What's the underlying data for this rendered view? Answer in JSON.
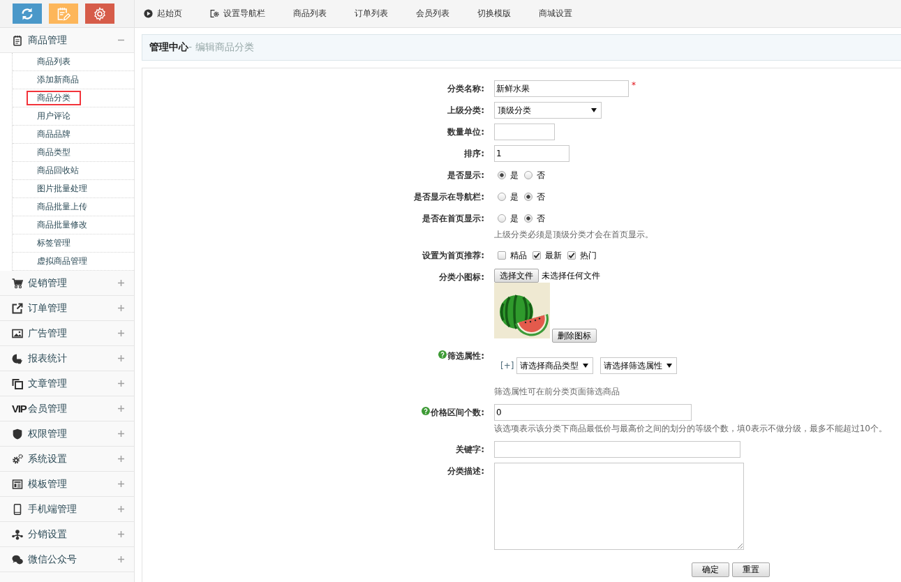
{
  "sidebar": {
    "menu": [
      {
        "label": "商品管理",
        "expanded": true,
        "children": [
          {
            "label": "商品列表",
            "selected": false
          },
          {
            "label": "添加新商品",
            "selected": false
          },
          {
            "label": "商品分类",
            "selected": true
          },
          {
            "label": "用户评论",
            "selected": false
          },
          {
            "label": "商品品牌",
            "selected": false
          },
          {
            "label": "商品类型",
            "selected": false
          },
          {
            "label": "商品回收站",
            "selected": false
          },
          {
            "label": "图片批量处理",
            "selected": false
          },
          {
            "label": "商品批量上传",
            "selected": false
          },
          {
            "label": "商品批量修改",
            "selected": false
          },
          {
            "label": "标签管理",
            "selected": false
          },
          {
            "label": "虚拟商品管理",
            "selected": false
          }
        ]
      },
      {
        "label": "促销管理",
        "expanded": false
      },
      {
        "label": "订单管理",
        "expanded": false
      },
      {
        "label": "广告管理",
        "expanded": false
      },
      {
        "label": "报表统计",
        "expanded": false
      },
      {
        "label": "文章管理",
        "expanded": false
      },
      {
        "label": "会员管理",
        "expanded": false,
        "icon_text": "VIP"
      },
      {
        "label": "权限管理",
        "expanded": false
      },
      {
        "label": "系统设置",
        "expanded": false
      },
      {
        "label": "模板管理",
        "expanded": false
      },
      {
        "label": "手机端管理",
        "expanded": false
      },
      {
        "label": "分销设置",
        "expanded": false
      },
      {
        "label": "微信公众号",
        "expanded": false
      }
    ]
  },
  "top_nav": [
    "起始页",
    "设置导航栏",
    "商品列表",
    "订单列表",
    "会员列表",
    "切换模版",
    "商城设置"
  ],
  "breadcrumb": {
    "root": "管理中心",
    "current": "- 编辑商品分类"
  },
  "form": {
    "rows": [
      {
        "kind": "text",
        "label": "分类名称:",
        "value": "新鲜水果",
        "required_mark": "*"
      },
      {
        "kind": "select",
        "label": "上级分类:",
        "value": "顶级分类"
      },
      {
        "kind": "text",
        "label": "数量单位:"
      },
      {
        "kind": "text",
        "label": "排序:",
        "value": "1"
      },
      {
        "kind": "radio",
        "label": "是否显示:",
        "options": [
          {
            "label": "是",
            "selected": true
          },
          {
            "label": "否",
            "selected": false
          }
        ]
      },
      {
        "kind": "radio",
        "label": "是否显示在导航栏:",
        "options": [
          {
            "label": "是",
            "selected": false
          },
          {
            "label": "否",
            "selected": true
          }
        ]
      },
      {
        "kind": "radio",
        "label": "是否在首页显示:",
        "options": [
          {
            "label": "是",
            "selected": false
          },
          {
            "label": "否",
            "selected": true
          }
        ],
        "note": "上级分类必须是顶级分类才会在首页显示。"
      },
      {
        "kind": "checkbox",
        "label": "设置为首页推荐:",
        "options": [
          {
            "label": "精品",
            "checked": false
          },
          {
            "label": "最新",
            "checked": true
          },
          {
            "label": "热门",
            "checked": true
          }
        ]
      },
      {
        "kind": "file",
        "label": "分类小图标:",
        "button": "选择文件",
        "status": "未选择任何文件",
        "delete_button": "删除图标"
      },
      {
        "kind": "filter",
        "label": "筛选属性:",
        "help": true,
        "add_link": "[+]",
        "selects": [
          "请选择商品类型",
          "请选择筛选属性"
        ],
        "note": "筛选属性可在前分类页面筛选商品"
      },
      {
        "kind": "text",
        "label": "价格区间个数:",
        "help": true,
        "value": "0",
        "note": "该选项表示该分类下商品最低价与最高价之间的划分的等级个数，填0表示不做分级，最多不能超过10个。"
      },
      {
        "kind": "text",
        "label": "关键字:"
      },
      {
        "kind": "textarea",
        "label": "分类描述:"
      }
    ],
    "buttons": [
      "确定",
      "重置"
    ]
  }
}
